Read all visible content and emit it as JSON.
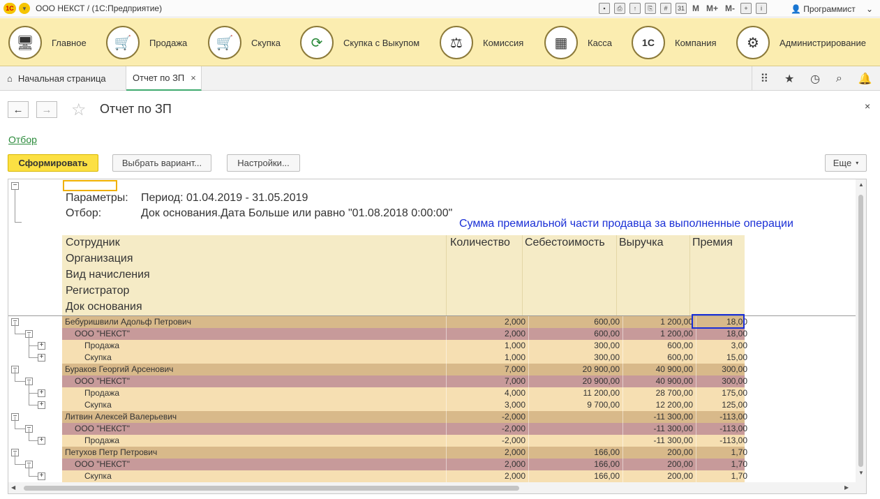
{
  "titlebar": {
    "title": "ООО НЕКСТ /  (1С:Предприятие)",
    "m_labels": [
      "M",
      "M+",
      "M-"
    ],
    "user": "Программист"
  },
  "sections": [
    {
      "label": "Главное",
      "icon": "computer-icon"
    },
    {
      "label": "Продажа",
      "icon": "cart-up-icon"
    },
    {
      "label": "Скупка",
      "icon": "cart-down-icon"
    },
    {
      "label": "Скупка с Выкупом",
      "icon": "cycle-arrows-icon"
    },
    {
      "label": "Комиссия",
      "icon": "scales-icon"
    },
    {
      "label": "Касса",
      "icon": "cash-register-icon"
    },
    {
      "label": "Компания",
      "icon": "company-logo-icon"
    },
    {
      "label": "Администрирование",
      "icon": "gears-icon"
    }
  ],
  "tabs": {
    "home": "Начальная страница",
    "active": "Отчет по ЗП"
  },
  "form": {
    "title": "Отчет по ЗП",
    "otbor": "Отбор",
    "generate": "Сформировать",
    "choose_variant": "Выбрать вариант...",
    "settings": "Настройки...",
    "more": "Еще"
  },
  "report": {
    "param_label": "Параметры:",
    "param_value": "Период: 01.04.2019 - 31.05.2019",
    "filter_label": "Отбор:",
    "filter_value": "Док основания.Дата Больше или равно \"01.08.2018 0:00:00\"",
    "annotation": "Сумма премиальной части продавца за выполненные операции",
    "group_headers": [
      "Сотрудник",
      "Организация",
      "Вид начисления",
      "Регистратор",
      "Док основания"
    ],
    "columns": [
      "Количество",
      "Себестоимость",
      "Выручка",
      "Премия"
    ],
    "rows": [
      {
        "level": 0,
        "name": "Бебуришвили Адольф Петрович",
        "qty": "2,000",
        "cost": "600,00",
        "revenue": "1 200,00",
        "bonus": "18,00"
      },
      {
        "level": 1,
        "name": "ООО \"НЕКСТ\"",
        "qty": "2,000",
        "cost": "600,00",
        "revenue": "1 200,00",
        "bonus": "18,00"
      },
      {
        "level": 2,
        "name": "Продажа",
        "qty": "1,000",
        "cost": "300,00",
        "revenue": "600,00",
        "bonus": "3,00"
      },
      {
        "level": 2,
        "name": "Скупка",
        "qty": "1,000",
        "cost": "300,00",
        "revenue": "600,00",
        "bonus": "15,00"
      },
      {
        "level": 0,
        "name": "Бураков Георгий Арсенович",
        "qty": "7,000",
        "cost": "20 900,00",
        "revenue": "40 900,00",
        "bonus": "300,00"
      },
      {
        "level": 1,
        "name": "ООО \"НЕКСТ\"",
        "qty": "7,000",
        "cost": "20 900,00",
        "revenue": "40 900,00",
        "bonus": "300,00"
      },
      {
        "level": 2,
        "name": "Продажа",
        "qty": "4,000",
        "cost": "11 200,00",
        "revenue": "28 700,00",
        "bonus": "175,00"
      },
      {
        "level": 2,
        "name": "Скупка",
        "qty": "3,000",
        "cost": "9 700,00",
        "revenue": "12 200,00",
        "bonus": "125,00"
      },
      {
        "level": 0,
        "name": "Литвин Алексей Валерьевич",
        "qty": "-2,000",
        "cost": "",
        "revenue": "-11 300,00",
        "bonus": "-113,00"
      },
      {
        "level": 1,
        "name": "ООО \"НЕКСТ\"",
        "qty": "-2,000",
        "cost": "",
        "revenue": "-11 300,00",
        "bonus": "-113,00"
      },
      {
        "level": 2,
        "name": "Продажа",
        "qty": "-2,000",
        "cost": "",
        "revenue": "-11 300,00",
        "bonus": "-113,00"
      },
      {
        "level": 0,
        "name": "Петухов Петр Петрович",
        "qty": "2,000",
        "cost": "166,00",
        "revenue": "200,00",
        "bonus": "1,70"
      },
      {
        "level": 1,
        "name": "ООО \"НЕКСТ\"",
        "qty": "2,000",
        "cost": "166,00",
        "revenue": "200,00",
        "bonus": "1,70"
      },
      {
        "level": 2,
        "name": "Скупка",
        "qty": "2,000",
        "cost": "166,00",
        "revenue": "200,00",
        "bonus": "1,70"
      }
    ]
  },
  "colors": {
    "sections_bg": "#fbedb0",
    "primary_button": "#fce043",
    "row_employee": "#d8b98a",
    "row_org": "#c79a9a",
    "row_operation": "#f6dfb2",
    "annotation": "#1a2fd6",
    "link": "#2a8a3a"
  }
}
